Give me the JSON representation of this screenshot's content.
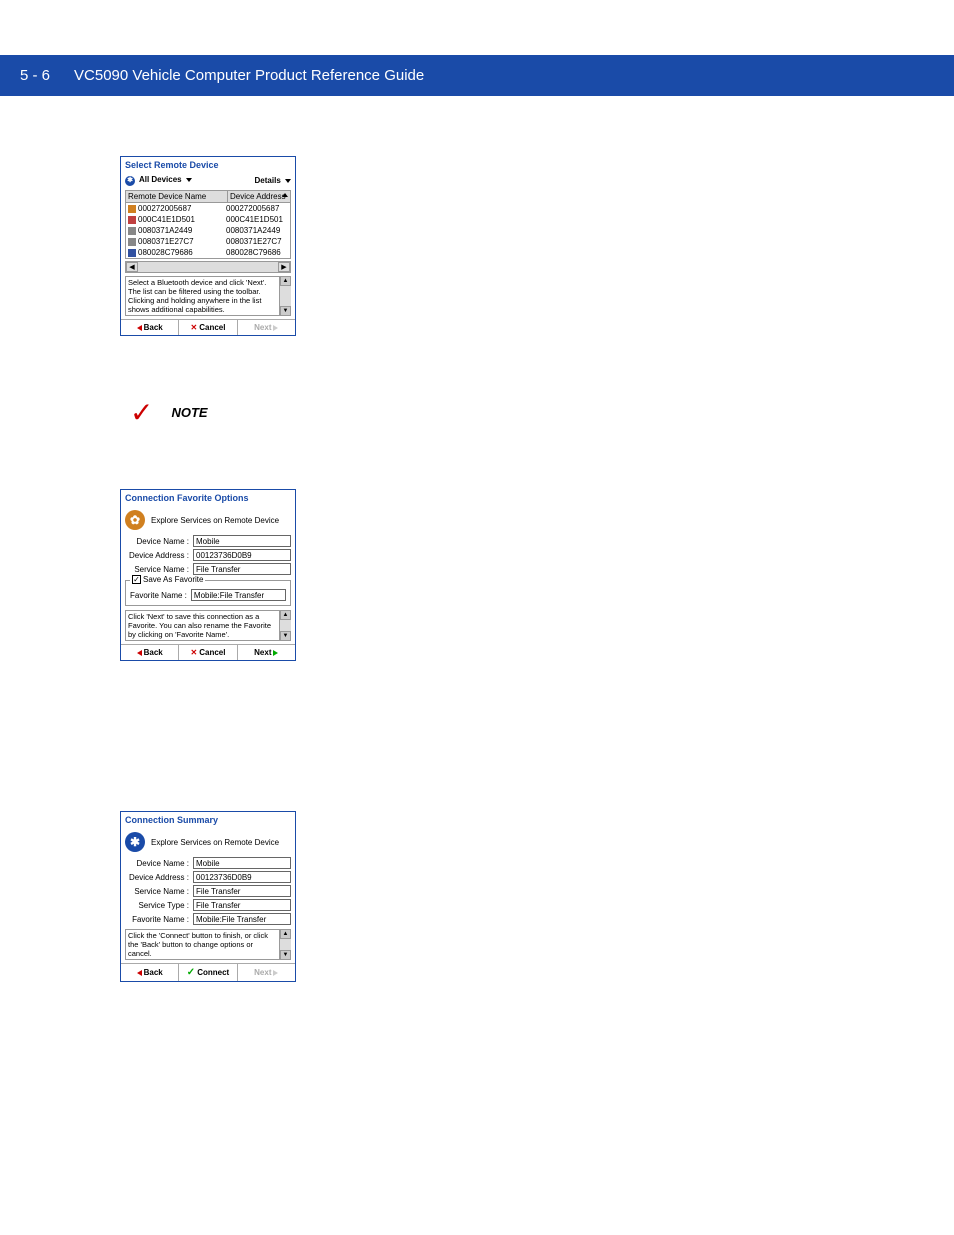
{
  "header": {
    "page_num": "5 - 6",
    "title": "VC5090 Vehicle Computer Product Reference Guide"
  },
  "note_label": "NOTE",
  "dialog1": {
    "title": "Select Remote Device",
    "all_devices_label": "All Devices",
    "details_label": "Details",
    "col_name": "Remote Device Name",
    "col_addr": "Device Address",
    "rows": [
      {
        "name": "000272005687",
        "addr": "000272005687"
      },
      {
        "name": "000C41E1D501",
        "addr": "000C41E1D501"
      },
      {
        "name": "0080371A2449",
        "addr": "0080371A2449"
      },
      {
        "name": "0080371E27C7",
        "addr": "0080371E27C7"
      },
      {
        "name": "080028C79686",
        "addr": "080028C79686"
      }
    ],
    "help": "Select a Bluetooth device and click 'Next'. The list can be filtered using the toolbar. Clicking and holding anywhere in the list shows additional capabilities.",
    "back": "Back",
    "cancel": "Cancel",
    "next": "Next"
  },
  "dialog2": {
    "title": "Connection Favorite Options",
    "subtitle": "Explore Services on Remote Device",
    "device_name_label": "Device Name :",
    "device_name": "Mobile",
    "device_addr_label": "Device Address :",
    "device_addr": "00123736D0B9",
    "service_name_label": "Service Name :",
    "service_name": "File Transfer",
    "save_fav_label": "Save As Favorite",
    "fav_name_label": "Favorite Name :",
    "fav_name": "Mobile:File Transfer",
    "help": "Click 'Next' to save this connection as a Favorite. You can also rename the Favorite by clicking on 'Favorite Name'.",
    "back": "Back",
    "cancel": "Cancel",
    "next": "Next"
  },
  "dialog3": {
    "title": "Connection Summary",
    "subtitle": "Explore Services on Remote Device",
    "device_name_label": "Device Name :",
    "device_name": "Mobile",
    "device_addr_label": "Device Address :",
    "device_addr": "00123736D0B9",
    "service_name_label": "Service Name :",
    "service_name": "File Transfer",
    "service_type_label": "Service Type :",
    "service_type": "File Transfer",
    "fav_name_label": "Favorite Name :",
    "fav_name": "Mobile:File Transfer",
    "help": "Click the 'Connect' button to finish, or click the 'Back' button to change options or cancel.",
    "back": "Back",
    "connect": "Connect",
    "next": "Next"
  }
}
